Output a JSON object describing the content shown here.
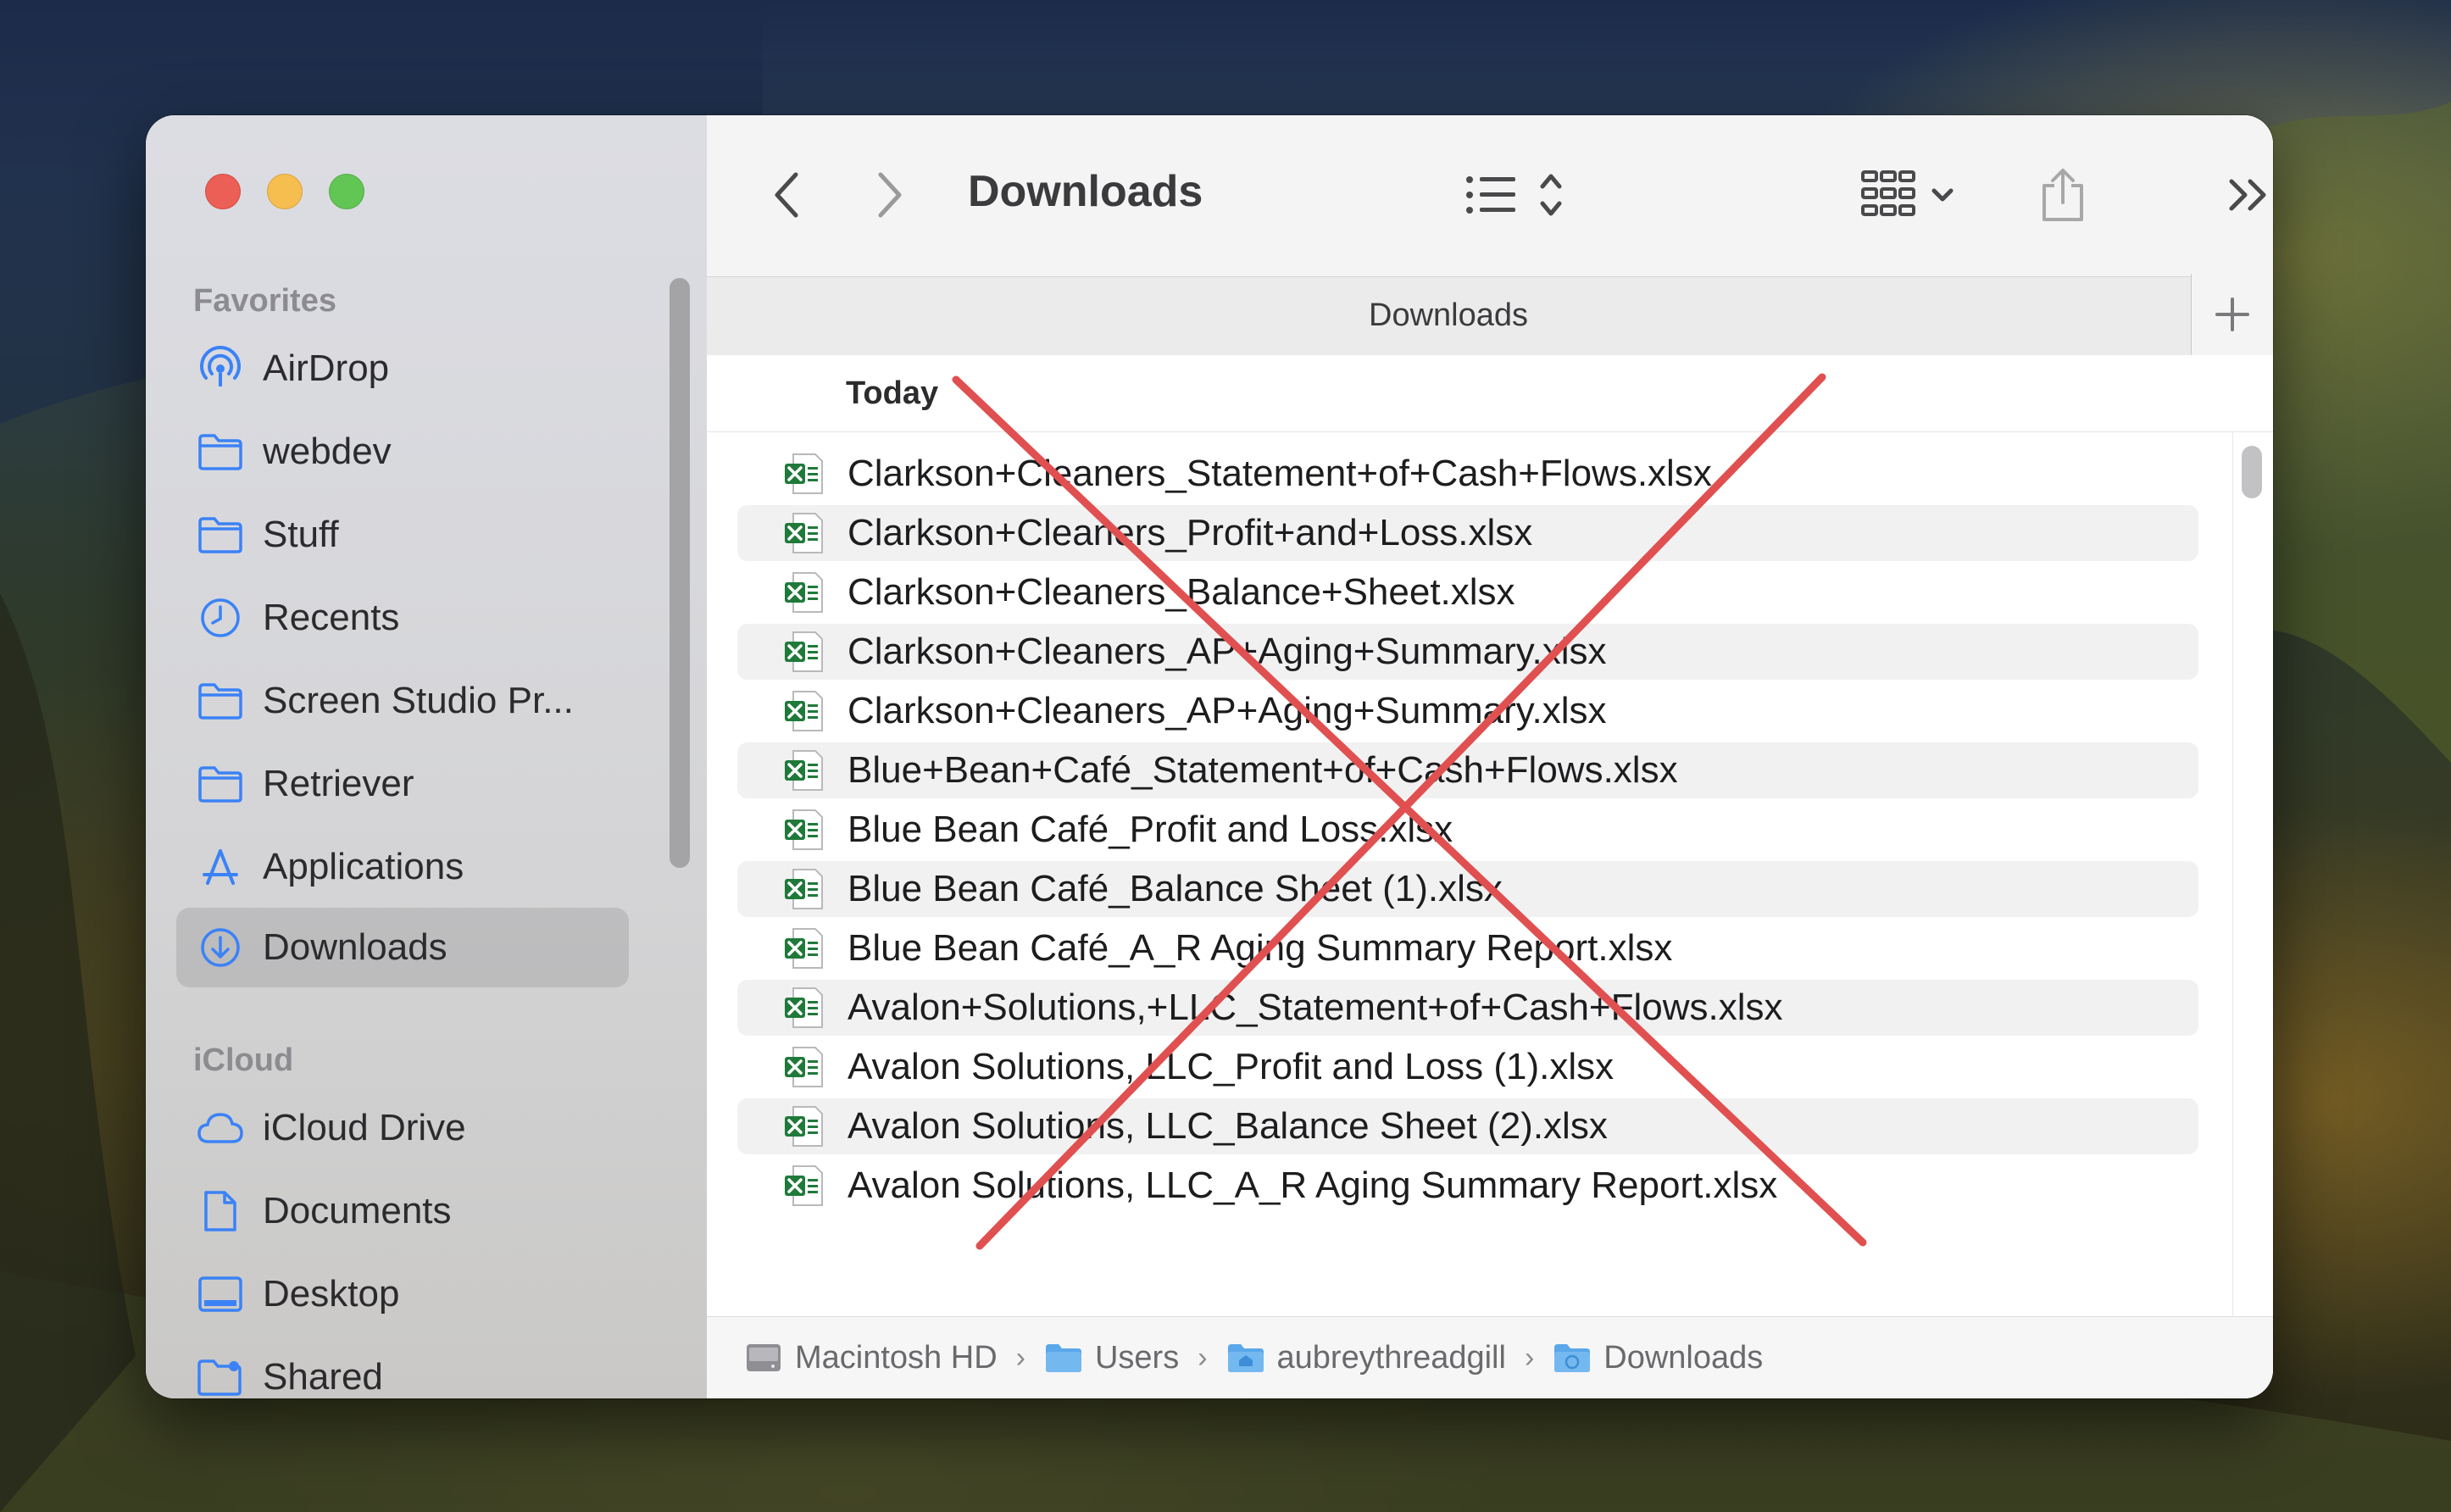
{
  "window": {
    "title": "Downloads",
    "tab_title": "Downloads"
  },
  "sidebar": {
    "favorites_header": "Favorites",
    "favorites": [
      {
        "label": "AirDrop",
        "icon": "airdrop-icon"
      },
      {
        "label": "webdev",
        "icon": "folder-icon"
      },
      {
        "label": "Stuff",
        "icon": "folder-icon"
      },
      {
        "label": "Recents",
        "icon": "clock-icon"
      },
      {
        "label": "Screen Studio Pr...",
        "icon": "folder-icon"
      },
      {
        "label": "Retriever",
        "icon": "folder-icon"
      },
      {
        "label": "Applications",
        "icon": "applications-icon"
      },
      {
        "label": "Downloads",
        "icon": "download-icon",
        "selected": true
      }
    ],
    "icloud_header": "iCloud",
    "icloud": [
      {
        "label": "iCloud Drive",
        "icon": "cloud-icon"
      },
      {
        "label": "Documents",
        "icon": "document-icon"
      },
      {
        "label": "Desktop",
        "icon": "desktop-icon"
      },
      {
        "label": "Shared",
        "icon": "shared-folder-icon"
      }
    ]
  },
  "group": {
    "title": "Today"
  },
  "files": [
    "Clarkson+Cleaners_Statement+of+Cash+Flows.xlsx",
    "Clarkson+Cleaners_Profit+and+Loss.xlsx",
    "Clarkson+Cleaners_Balance+Sheet.xlsx",
    "Clarkson+Cleaners_AP+Aging+Summary.xlsx",
    "Clarkson+Cleaners_AP+Aging+Summary.xlsx",
    "Blue+Bean+Café_Statement+of+Cash+Flows.xlsx",
    "Blue Bean Café_Profit and Loss.xlsx",
    "Blue Bean Café_Balance Sheet (1).xlsx",
    "Blue Bean Café_A_R Aging Summary Report.xlsx",
    "Avalon+Solutions,+LLC_Statement+of+Cash+Flows.xlsx",
    "Avalon Solutions, LLC_Profit and Loss (1).xlsx",
    "Avalon Solutions, LLC_Balance Sheet (2).xlsx",
    "Avalon Solutions, LLC_A_R Aging Summary Report.xlsx"
  ],
  "pathbar": [
    "Macintosh HD",
    "Users",
    "aubreythreadgill",
    "Downloads"
  ],
  "colors": {
    "accent": "#3b82f6",
    "cross_mark": "#e05050",
    "excel_green": "#1f7a3a"
  }
}
